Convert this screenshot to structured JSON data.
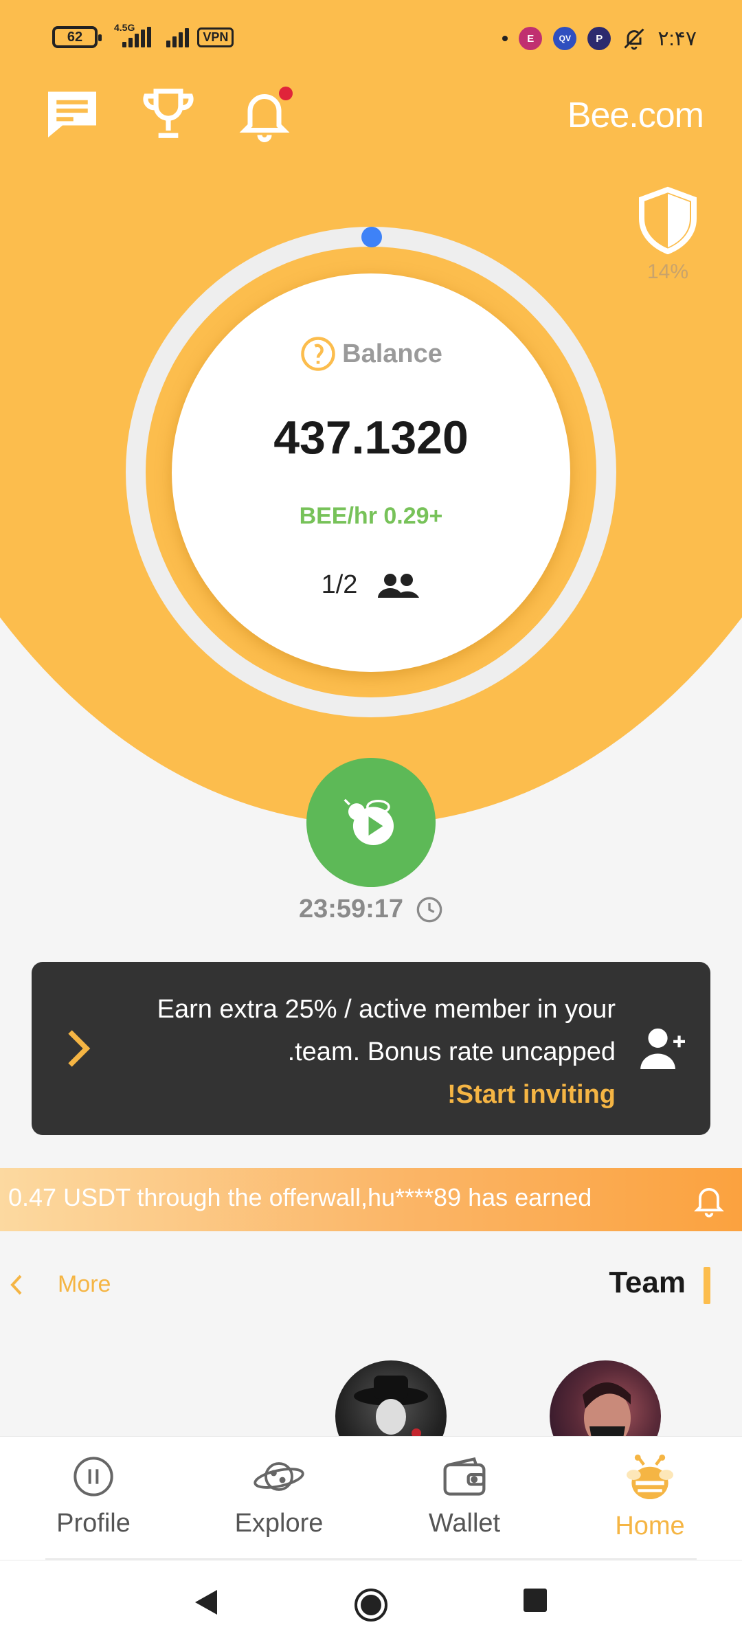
{
  "status_bar": {
    "battery": "62",
    "network": "4.5G",
    "vpn": "VPN",
    "app_icons": [
      "E",
      "QV",
      "P"
    ],
    "time": "۲:۴۷"
  },
  "header": {
    "brand": "Bee.com",
    "icons": [
      "chat-icon",
      "trophy-icon",
      "bell-icon"
    ]
  },
  "security": {
    "percent": "14%"
  },
  "balance": {
    "title": "Balance",
    "amount": "437.1320",
    "rate": "BEE/hr 0.29+",
    "members": "1/2"
  },
  "mining": {
    "timer": "23:59:17"
  },
  "invite": {
    "line1": "Earn extra 25% / active member in your",
    "line2": ".team. Bonus rate uncapped",
    "cta": "!Start inviting"
  },
  "ticker": {
    "text": "0.47 USDT through the offerwall,hu****89 has earned"
  },
  "team": {
    "more": "More",
    "title": "Team"
  },
  "bottom_nav": {
    "profile": "Profile",
    "explore": "Explore",
    "wallet": "Wallet",
    "home": "Home",
    "active": "Home"
  },
  "colors": {
    "primary": "#fcbd4d",
    "accent_text": "#f5b544",
    "green": "#5db957",
    "rate_green": "#77c259",
    "dark_card": "#333333",
    "ring_dot": "#3e82f7"
  }
}
